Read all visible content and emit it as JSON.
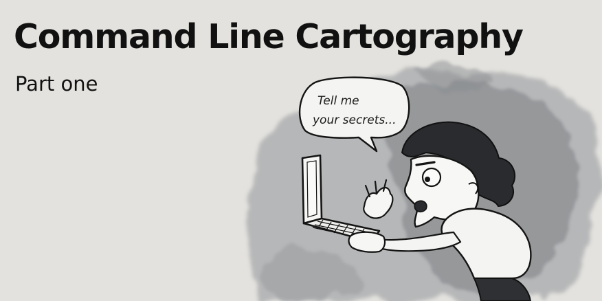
{
  "header": {
    "title": "Command Line Cartography",
    "subtitle": "Part one"
  },
  "illustration": {
    "speech_bubble": {
      "line1": "Tell me",
      "line2": "your secrets..."
    },
    "icon": "person-with-laptop-illustration"
  },
  "colors": {
    "background": "#e3e2de",
    "ink": "#111111",
    "wash": "#8d8f92"
  }
}
